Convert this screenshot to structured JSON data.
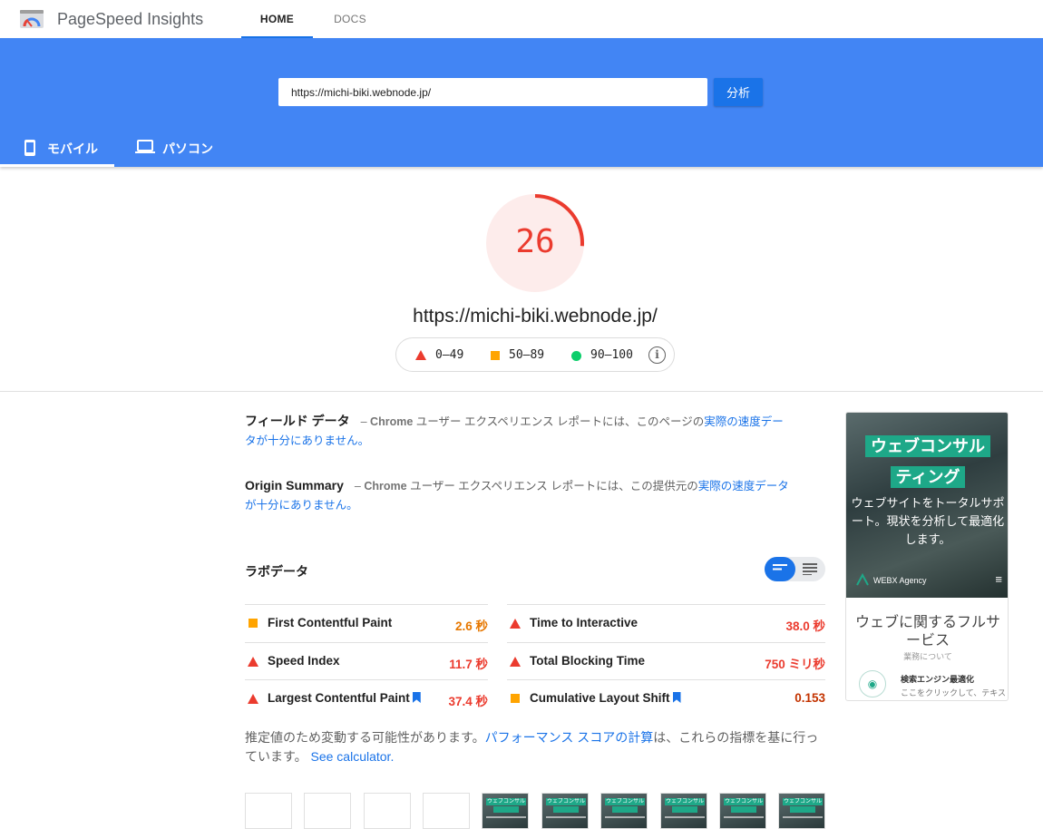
{
  "app": {
    "name": "PageSpeed Insights"
  },
  "nav": {
    "home": "HOME",
    "docs": "DOCS"
  },
  "search": {
    "url_value": "https://michi-biki.webnode.jp/",
    "analyze_label": "分析"
  },
  "device_tabs": {
    "mobile": "モバイル",
    "desktop": "パソコン",
    "selected": "mobile"
  },
  "score": {
    "value": "26",
    "fraction": 0.26,
    "color": "#eb3b2e",
    "bg": "#fdeceb"
  },
  "page_url": "https://michi-biki.webnode.jp/",
  "legend": {
    "fail": "0–49",
    "average": "50–89",
    "pass": "90–100"
  },
  "field_data": {
    "title": "フィールド データ",
    "dash": "–",
    "chrome": "Chrome",
    "text": " ユーザー エクスペリエンス レポートには、このページの",
    "link": "実際の速度データが十分にありません。"
  },
  "origin_summary": {
    "title": "Origin Summary",
    "dash": "–",
    "chrome": "Chrome",
    "text": " ユーザー エクスペリエンス レポートには、この提供元の",
    "link": "実際の速度データが十分にありません。"
  },
  "lab": {
    "title": "ラボデータ",
    "metrics_left": [
      {
        "name": "First Contentful Paint",
        "value": "2.6 秒",
        "status": "average"
      },
      {
        "name": "Speed Index",
        "value": "11.7 秒",
        "status": "fail"
      },
      {
        "name": "Largest Contentful Paint",
        "value": "37.4 秒",
        "status": "fail"
      }
    ],
    "metrics_right": [
      {
        "name": "Time to Interactive",
        "value": "38.0 秒",
        "status": "fail"
      },
      {
        "name": "Total Blocking Time",
        "value": "750 ミリ秒",
        "status": "fail"
      },
      {
        "name": "Cumulative Layout Shift",
        "value": "0.153",
        "status": "average"
      }
    ],
    "note_text": "推定値のため変動する可能性があります。",
    "note_link": "パフォーマンス スコアの計算",
    "note_text2": "は、これらの指標を基に行っています。",
    "note_link2": "See calculator."
  },
  "screenshot": {
    "title_line1": "ウェブコンサル",
    "title_line2": "ティング",
    "subtitle": "ウェブサイトをトータルサポート。現状を分析して最適化します。",
    "agency": "WEBX Agency",
    "menu": "≡",
    "heading": "ウェブに関するフルサービス",
    "small": "業務について",
    "seo": "検索エンジン最適化",
    "click_text": "ここをクリックして、テキスト",
    "eye": "◉"
  },
  "filmstrip": {
    "frame_text": "ウェブコンサル"
  },
  "colors": {
    "accent": "#4285f4",
    "link": "#1a73e8",
    "fail": "#eb3b2e",
    "average": "#ffa400",
    "pass": "#0cce6b"
  }
}
